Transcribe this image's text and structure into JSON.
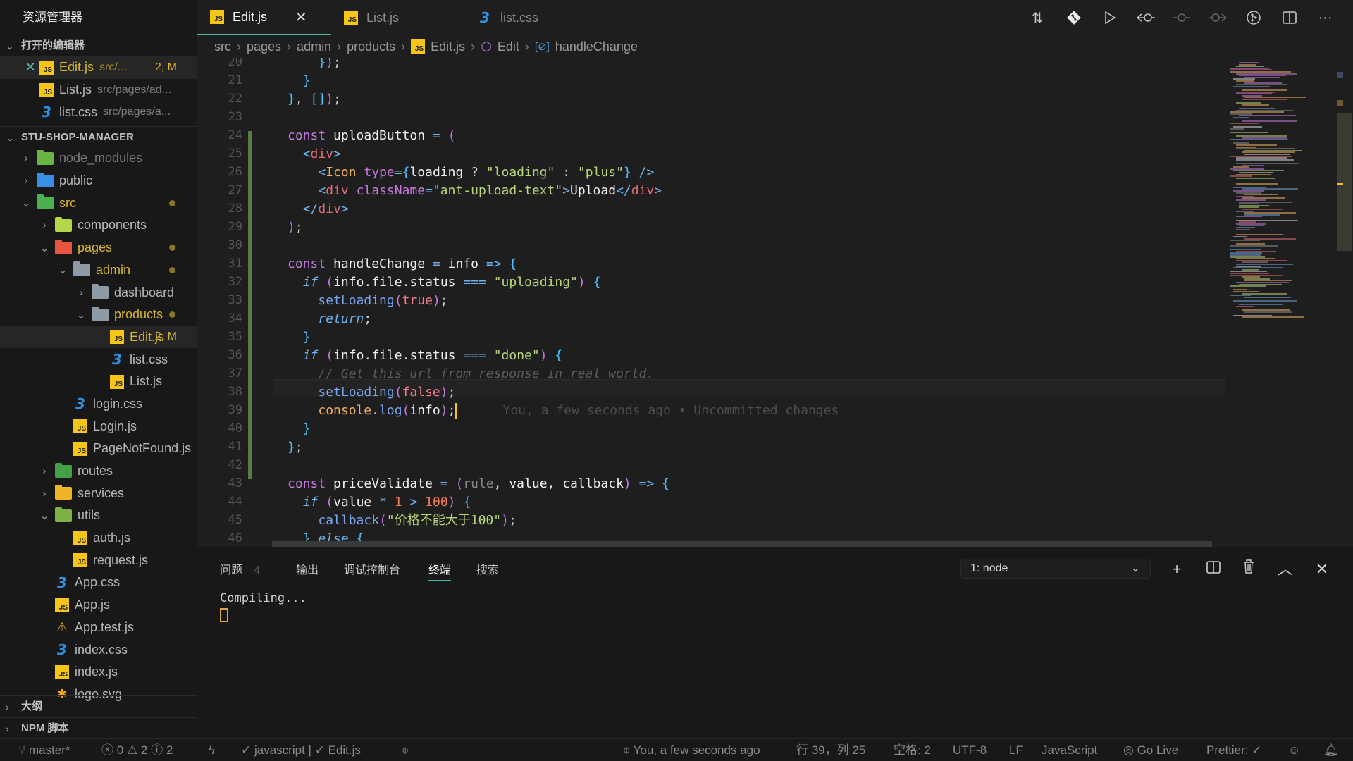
{
  "sidebar": {
    "title": "资源管理器",
    "open_editors": {
      "label": "打开的编辑器",
      "items": [
        {
          "name": "Edit.js",
          "desc": "src/...",
          "badge": "2, M",
          "icon": "js-file-icon"
        },
        {
          "name": "List.js",
          "desc": "src/pages/ad...",
          "icon": "js-file-icon"
        },
        {
          "name": "list.css",
          "desc": "src/pages/a...",
          "icon": "css-file-icon"
        }
      ]
    },
    "project": {
      "label": "STU-SHOP-MANAGER",
      "tree": [
        {
          "name": "node_modules",
          "type": "folder",
          "expanded": false
        },
        {
          "name": "public",
          "type": "folder",
          "expanded": false
        },
        {
          "name": "src",
          "type": "folder",
          "expanded": true
        },
        {
          "name": "components",
          "type": "folder",
          "expanded": false
        },
        {
          "name": "pages",
          "type": "folder",
          "expanded": true
        },
        {
          "name": "admin",
          "type": "folder",
          "expanded": true
        },
        {
          "name": "dashboard",
          "type": "folder",
          "expanded": false
        },
        {
          "name": "products",
          "type": "folder",
          "expanded": true
        },
        {
          "name": "Edit.js",
          "type": "js",
          "badge": "2, M"
        },
        {
          "name": "list.css",
          "type": "css"
        },
        {
          "name": "List.js",
          "type": "js"
        },
        {
          "name": "login.css",
          "type": "css"
        },
        {
          "name": "Login.js",
          "type": "js"
        },
        {
          "name": "PageNotFound.js",
          "type": "js"
        },
        {
          "name": "routes",
          "type": "folder",
          "expanded": false
        },
        {
          "name": "services",
          "type": "folder",
          "expanded": false
        },
        {
          "name": "utils",
          "type": "folder",
          "expanded": true
        },
        {
          "name": "auth.js",
          "type": "js"
        },
        {
          "name": "request.js",
          "type": "js"
        },
        {
          "name": "App.css",
          "type": "css"
        },
        {
          "name": "App.js",
          "type": "js"
        },
        {
          "name": "App.test.js",
          "type": "test"
        },
        {
          "name": "index.css",
          "type": "css"
        },
        {
          "name": "index.js",
          "type": "js"
        },
        {
          "name": "logo.svg",
          "type": "svg"
        }
      ]
    },
    "outline_label": "大纲",
    "npm_label": "NPM 脚本"
  },
  "tabs": [
    {
      "label": "Edit.js",
      "icon": "js-file-icon",
      "active": true
    },
    {
      "label": "List.js",
      "icon": "js-file-icon",
      "active": false
    },
    {
      "label": "list.css",
      "icon": "css-file-icon",
      "active": false
    }
  ],
  "toolbar": [
    "compare-changes-icon",
    "git-icon",
    "run-icon",
    "previous-change-icon",
    "current-change-icon",
    "next-change-icon",
    "git-graph-icon",
    "split-editor-icon",
    "more-actions-icon"
  ],
  "breadcrumb": [
    "src",
    "pages",
    "admin",
    "products",
    "Edit.js",
    "Edit",
    "handleChange"
  ],
  "editor": {
    "first_line": 20,
    "cursor_line": 39,
    "blame": "You, a few seconds ago • Uncommitted changes",
    "lines": [
      "    });",
      "  }",
      "}, []);",
      "",
      "const uploadButton = (",
      "  <div>",
      "    <Icon type={loading ? \"loading\" : \"plus\"} />",
      "    <div className=\"ant-upload-text\">Upload</div>",
      "  </div>",
      ");",
      "",
      "const handleChange = info => {",
      "  if (info.file.status === \"uploading\") {",
      "    setLoading(true);",
      "    return;",
      "  }",
      "  if (info.file.status === \"done\") {",
      "    // Get this url from response in real world.",
      "    setLoading(false);",
      "    console.log(info);",
      "  }",
      "};",
      "",
      "const priceValidate = (rule, value, callback) => {",
      "  if (value * 1 > 100) {",
      "    callback(\"价格不能大于100\");",
      "  } else {"
    ]
  },
  "panel": {
    "tabs": [
      {
        "label": "问题",
        "count": "4"
      },
      {
        "label": "输出"
      },
      {
        "label": "调试控制台"
      },
      {
        "label": "终端",
        "active": true
      },
      {
        "label": "搜索"
      }
    ],
    "terminal_select": "1: node",
    "terminal_output": "Compiling..."
  },
  "status": {
    "branch": "master*",
    "errors": "0",
    "warnings": "2",
    "infos": "2",
    "eslint": "javascript | ✓ Edit.js",
    "blame": "You, a few seconds ago",
    "position": "行 39，列 25",
    "spaces": "空格: 2",
    "encoding": "UTF-8",
    "eol": "LF",
    "language": "JavaScript",
    "golive": "Go Live",
    "prettier": "Prettier: ✓"
  }
}
